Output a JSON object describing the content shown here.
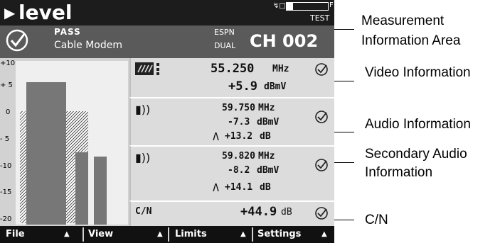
{
  "title": "level",
  "status": {
    "test_label": "TEST",
    "battery_level": 0.15,
    "battery_end": "F"
  },
  "info": {
    "result": "PASS",
    "device": "Cable Modem",
    "channel_name": "ESPN",
    "channel_mode": "DUAL",
    "channel": "CH 002"
  },
  "graph": {
    "ticks": [
      "+10",
      "+ 5",
      "0",
      "- 5",
      "-10",
      "-15",
      "-20"
    ],
    "bars": [
      {
        "type": "video",
        "value": 5.9
      },
      {
        "type": "audio",
        "value": -7.3
      },
      {
        "type": "sap",
        "value": -8.2
      }
    ],
    "ylim": [
      -20,
      10
    ]
  },
  "video": {
    "icon": "video-signal-icon",
    "freq": "55.250",
    "freq_unit": "MHz",
    "level": "+5.9",
    "level_unit": "dBmV"
  },
  "audio": {
    "icon": "speaker-icon",
    "freq": "59.750",
    "freq_unit": "MHz",
    "level": "-7.3",
    "level_unit": "dBmV",
    "delta": "+13.2",
    "delta_unit": "dB"
  },
  "sap": {
    "icon": "speaker-icon",
    "freq": "59.820",
    "freq_unit": "MHz",
    "level": "-8.2",
    "level_unit": "dBmV",
    "delta": "+14.1",
    "delta_unit": "dB"
  },
  "cn": {
    "label": "C/N",
    "value": "+44.9",
    "unit": "dB"
  },
  "softkeys": [
    {
      "label": "File"
    },
    {
      "label": "View"
    },
    {
      "label": "Limits"
    },
    {
      "label": "Settings"
    }
  ],
  "callouts": {
    "measurement_line1": "Measurement",
    "measurement_line2": "Information  Area",
    "video": "Video Information",
    "audio": "Audio Information",
    "sap_line1": "Secondary Audio",
    "sap_line2": "Information",
    "cn": "C/N"
  },
  "colors": {
    "bar": "#777777",
    "header": "#1c1c1c",
    "info_bar": "#5a5a5a",
    "panel": "#dcdcdc"
  }
}
